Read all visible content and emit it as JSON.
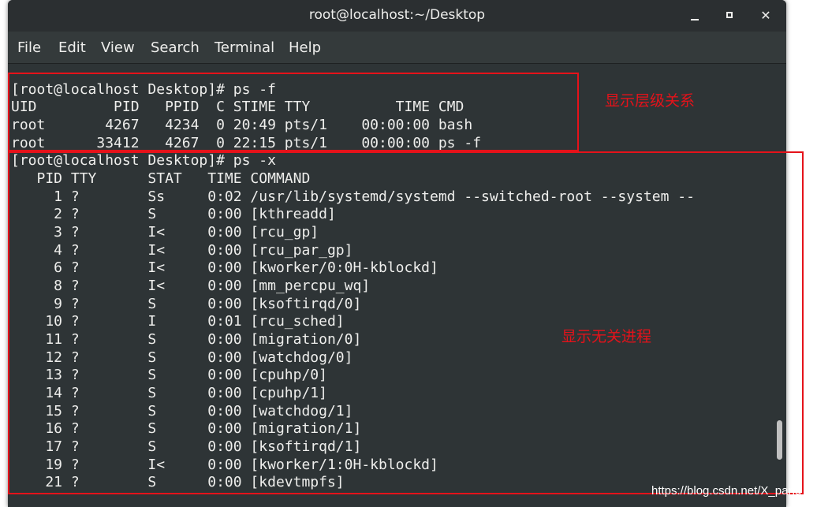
{
  "window": {
    "title": "root@localhost:~/Desktop",
    "controls": {
      "minimize": "minimize-icon",
      "maximize": "maximize-icon",
      "close": "✕"
    }
  },
  "menubar": {
    "items": [
      "File",
      "Edit",
      "View",
      "Search",
      "Terminal",
      "Help"
    ]
  },
  "terminal": {
    "lines": [
      "[root@localhost Desktop]# ps -f",
      "UID         PID   PPID  C STIME TTY          TIME CMD",
      "root       4267   4234  0 20:49 pts/1    00:00:00 bash",
      "root      33412   4267  0 22:15 pts/1    00:00:00 ps -f",
      "[root@localhost Desktop]# ps -x",
      "   PID TTY      STAT   TIME COMMAND",
      "     1 ?        Ss     0:02 /usr/lib/systemd/systemd --switched-root --system --",
      "     2 ?        S      0:00 [kthreadd]",
      "     3 ?        I<     0:00 [rcu_gp]",
      "     4 ?        I<     0:00 [rcu_par_gp]",
      "     6 ?        I<     0:00 [kworker/0:0H-kblockd]",
      "     8 ?        I<     0:00 [mm_percpu_wq]",
      "     9 ?        S      0:00 [ksoftirqd/0]",
      "    10 ?        I      0:01 [rcu_sched]",
      "    11 ?        S      0:00 [migration/0]",
      "    12 ?        S      0:00 [watchdog/0]",
      "    13 ?        S      0:00 [cpuhp/0]",
      "    14 ?        S      0:00 [cpuhp/1]",
      "    15 ?        S      0:00 [watchdog/1]",
      "    16 ?        S      0:00 [migration/1]",
      "    17 ?        S      0:00 [ksoftirqd/1]",
      "    19 ?        I<     0:00 [kworker/1:0H-kblockd]",
      "    21 ?        S      0:00 [kdevtmpfs]"
    ]
  },
  "annotations": {
    "hierarchy": "显示层级关系",
    "unrelated": "显示无关进程"
  },
  "watermark": "https://blog.csdn.net/X_pang",
  "colors": {
    "terminal_bg": "#2e3436",
    "terminal_fg": "#eeeeec",
    "annotation_red": "#e5121a"
  }
}
